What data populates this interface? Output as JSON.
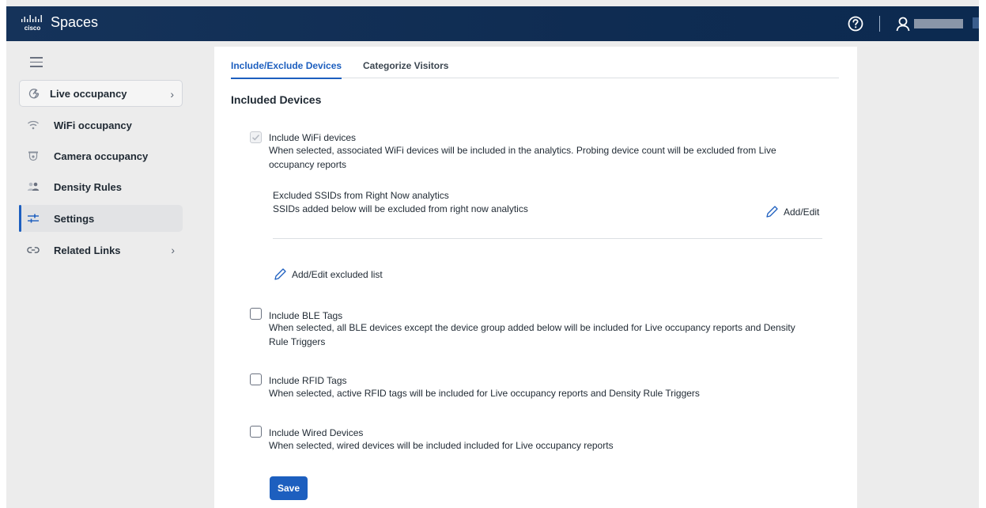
{
  "header": {
    "brand": "Spaces",
    "logo_icon": "cisco-logo",
    "help_icon": "help-circle-icon",
    "user_icon": "user-icon"
  },
  "sidebar": {
    "menu_icon": "hamburger-icon",
    "items": [
      {
        "label": "Live occupancy",
        "icon": "live-occupancy-icon",
        "has_chevron": true
      },
      {
        "label": "WiFi occupancy",
        "icon": "wifi-icon"
      },
      {
        "label": "Camera occupancy",
        "icon": "camera-icon"
      },
      {
        "label": "Density Rules",
        "icon": "people-icon"
      },
      {
        "label": "Settings",
        "icon": "sliders-icon",
        "active": true
      },
      {
        "label": "Related Links",
        "icon": "link-icon",
        "has_chevron": true
      }
    ],
    "chevron": "›"
  },
  "tabs": [
    {
      "label": "Include/Exclude Devices",
      "active": true
    },
    {
      "label": "Categorize Visitors",
      "active": false
    }
  ],
  "main": {
    "section_title": "Included Devices",
    "wifi": {
      "checked": true,
      "label": "Include WiFi devices",
      "desc_line1": "When selected, associated WiFi devices will be included in the analytics. Probing device count will be excluded from Live",
      "desc_line2": "occupancy reports",
      "excluded_title": "Excluded SSIDs from Right Now analytics",
      "excluded_desc": "SSIDs added below will be excluded from right now analytics",
      "add_edit": "Add/Edit",
      "add_edit_list": "Add/Edit excluded list"
    },
    "ble": {
      "checked": false,
      "label": "Include BLE Tags",
      "desc_line1": "When selected, all BLE devices except the device group added below will be included for Live occupancy reports and Density",
      "desc_line2": "Rule Triggers"
    },
    "rfid": {
      "checked": false,
      "label": "Include RFID Tags",
      "desc_line1": "When selected, active RFID tags will be included for Live occupancy reports and Density Rule Triggers"
    },
    "wired": {
      "checked": false,
      "label": "Include Wired Devices",
      "desc_line1": "When selected, wired devices will be included included for Live occupancy reports"
    },
    "save_label": "Save"
  },
  "colors": {
    "topbar": "#0f2c52",
    "accent": "#1d5fbf",
    "background": "#ececec"
  }
}
